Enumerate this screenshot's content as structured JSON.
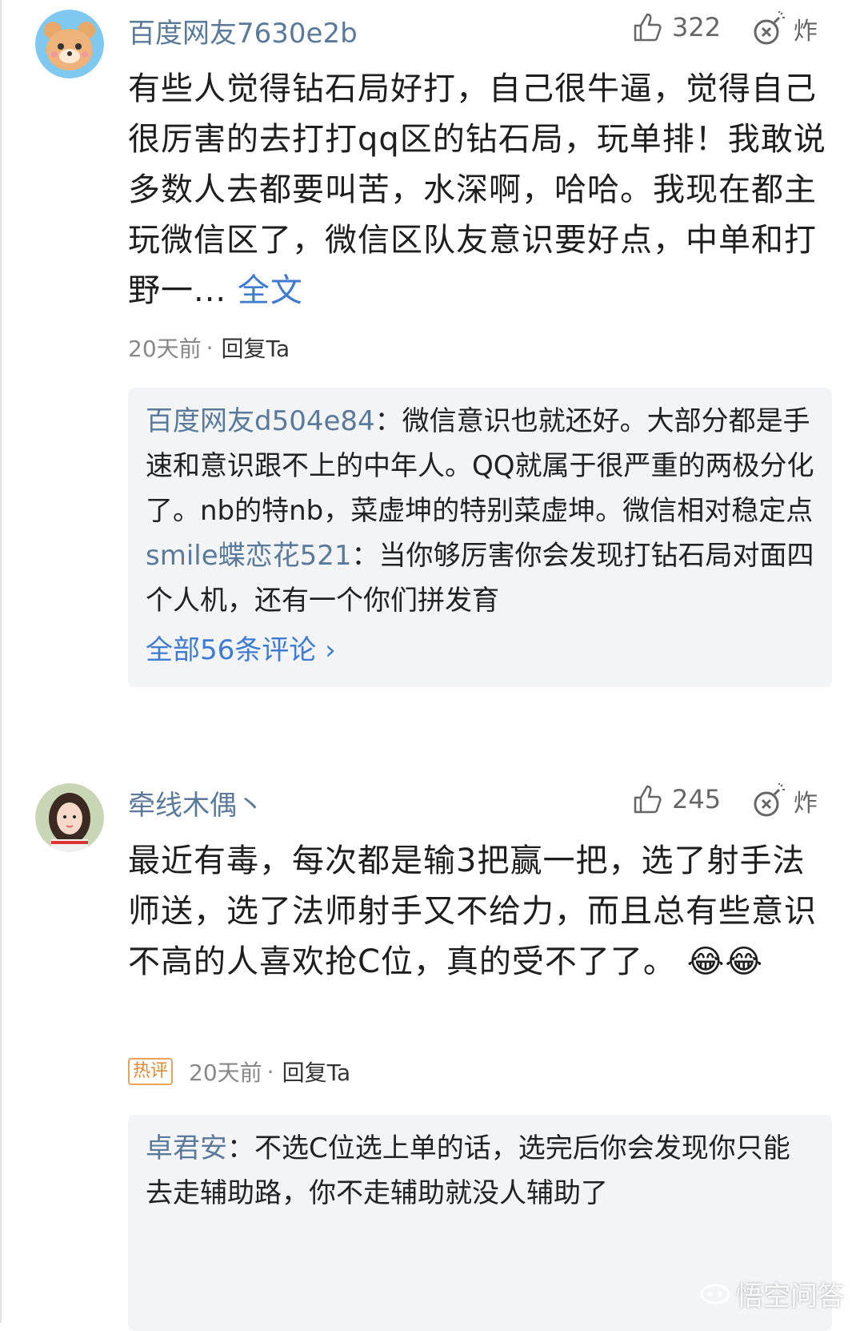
{
  "comments": [
    {
      "username": "百度网友7630e2b",
      "likes": "322",
      "bomb_label": "炸",
      "text": "有些人觉得钻石局好打，自己很牛逼，觉得自己很厉害的去打打qq区的钻石局，玩单排！我敢说多数人去都要叫苦，水深啊，哈哈。我现在都主玩微信区了，微信区队友意识要好点，中单和打野一...",
      "more_label": "全文",
      "time": "20天前",
      "separator": "·",
      "reply_label": "回复Ta",
      "replies": [
        {
          "name": "百度网友d504e84",
          "colon": "：",
          "text": "微信意识也就还好。大部分都是手速和意识跟不上的中年人。QQ就属于很严重的两极分化了。nb的特nb，菜虚坤的特别菜虚坤。微信相对稳定点"
        },
        {
          "name": "smile蝶恋花521",
          "colon": "：",
          "text": "当你够厉害你会发现打钻石局对面四个人机，还有一个你们拼发育"
        }
      ],
      "all_replies_label": "全部56条评论",
      "all_replies_chevron": "›"
    },
    {
      "username": "牵线木偶丶",
      "likes": "245",
      "bomb_label": "炸",
      "text": "最近有毒，每次都是输3把赢一把，选了射手法师送，选了法师射手又不给力，而且总有些意识不高的人喜欢抢C位，真的受不了了。",
      "emoji": "😂😂",
      "badge": "热评",
      "time": "20天前",
      "separator": "·",
      "reply_label": "回复Ta",
      "replies": [
        {
          "name": "卓君安",
          "colon": "：",
          "text": "不选C位选上单的话，选完后你会发现你只能去走辅助路，你不走辅助就没人辅助了"
        }
      ]
    }
  ],
  "watermark": "悟空问答",
  "colors": {
    "link": "#3f7bd0",
    "username": "#5b7a99",
    "badge": "#e0883a",
    "reply_bg": "#f3f4f6"
  }
}
